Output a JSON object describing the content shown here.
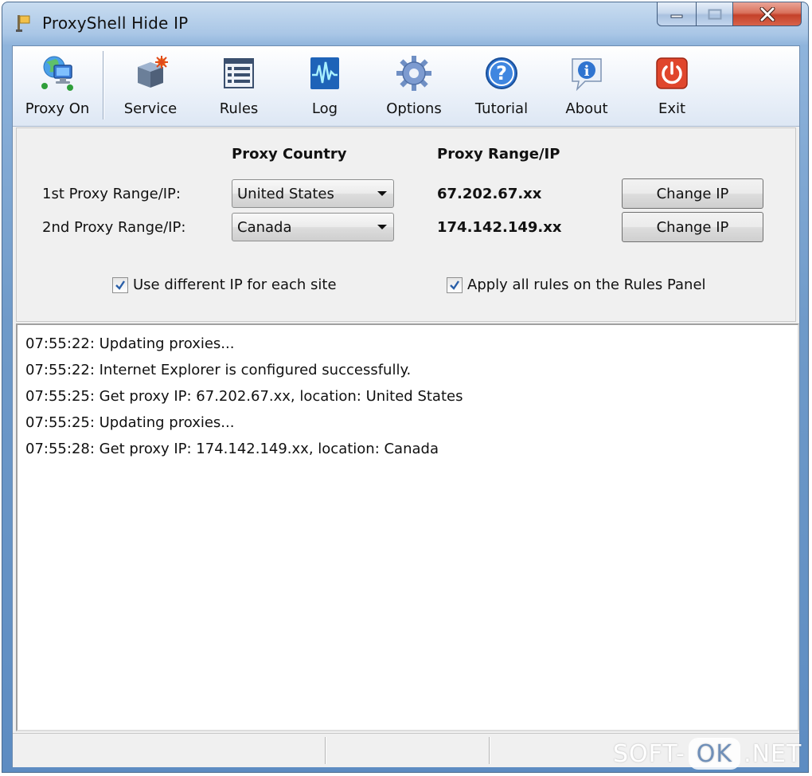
{
  "window": {
    "title": "ProxyShell Hide IP"
  },
  "toolbar": {
    "items": [
      {
        "label": "Proxy On",
        "icon": "network-computer-icon"
      },
      {
        "label": "Service",
        "icon": "service-box-icon"
      },
      {
        "label": "Rules",
        "icon": "rules-list-icon"
      },
      {
        "label": "Log",
        "icon": "log-waveform-icon"
      },
      {
        "label": "Options",
        "icon": "gear-icon"
      },
      {
        "label": "Tutorial",
        "icon": "help-question-icon"
      },
      {
        "label": "About",
        "icon": "info-icon"
      },
      {
        "label": "Exit",
        "icon": "power-icon"
      }
    ]
  },
  "settings": {
    "header_country": "Proxy Country",
    "header_range": "Proxy Range/IP",
    "rows": [
      {
        "label": "1st Proxy Range/IP:",
        "country": "United States",
        "ip": "67.202.67.xx",
        "button": "Change IP"
      },
      {
        "label": "2nd Proxy Range/IP:",
        "country": "Canada",
        "ip": "174.142.149.xx",
        "button": "Change IP"
      }
    ],
    "use_different_ip": {
      "label": "Use different IP for each site",
      "checked": true
    },
    "apply_rules": {
      "label": "Apply all rules on the Rules Panel",
      "checked": true
    }
  },
  "log": {
    "lines": [
      "07:55:22: Updating proxies...",
      "07:55:22: Internet Explorer is configured successfully.",
      "07:55:25: Get proxy IP: 67.202.67.xx, location: United States",
      "07:55:25: Updating proxies...",
      "07:55:28: Get proxy IP: 174.142.149.xx, location: Canada"
    ]
  },
  "watermark": {
    "left": "SOFT-",
    "middle": "OK",
    "right": ".NET"
  },
  "colors": {
    "accent_blue": "#3b7bd6",
    "exit_red": "#e0462c",
    "close_red": "#c4412a"
  }
}
